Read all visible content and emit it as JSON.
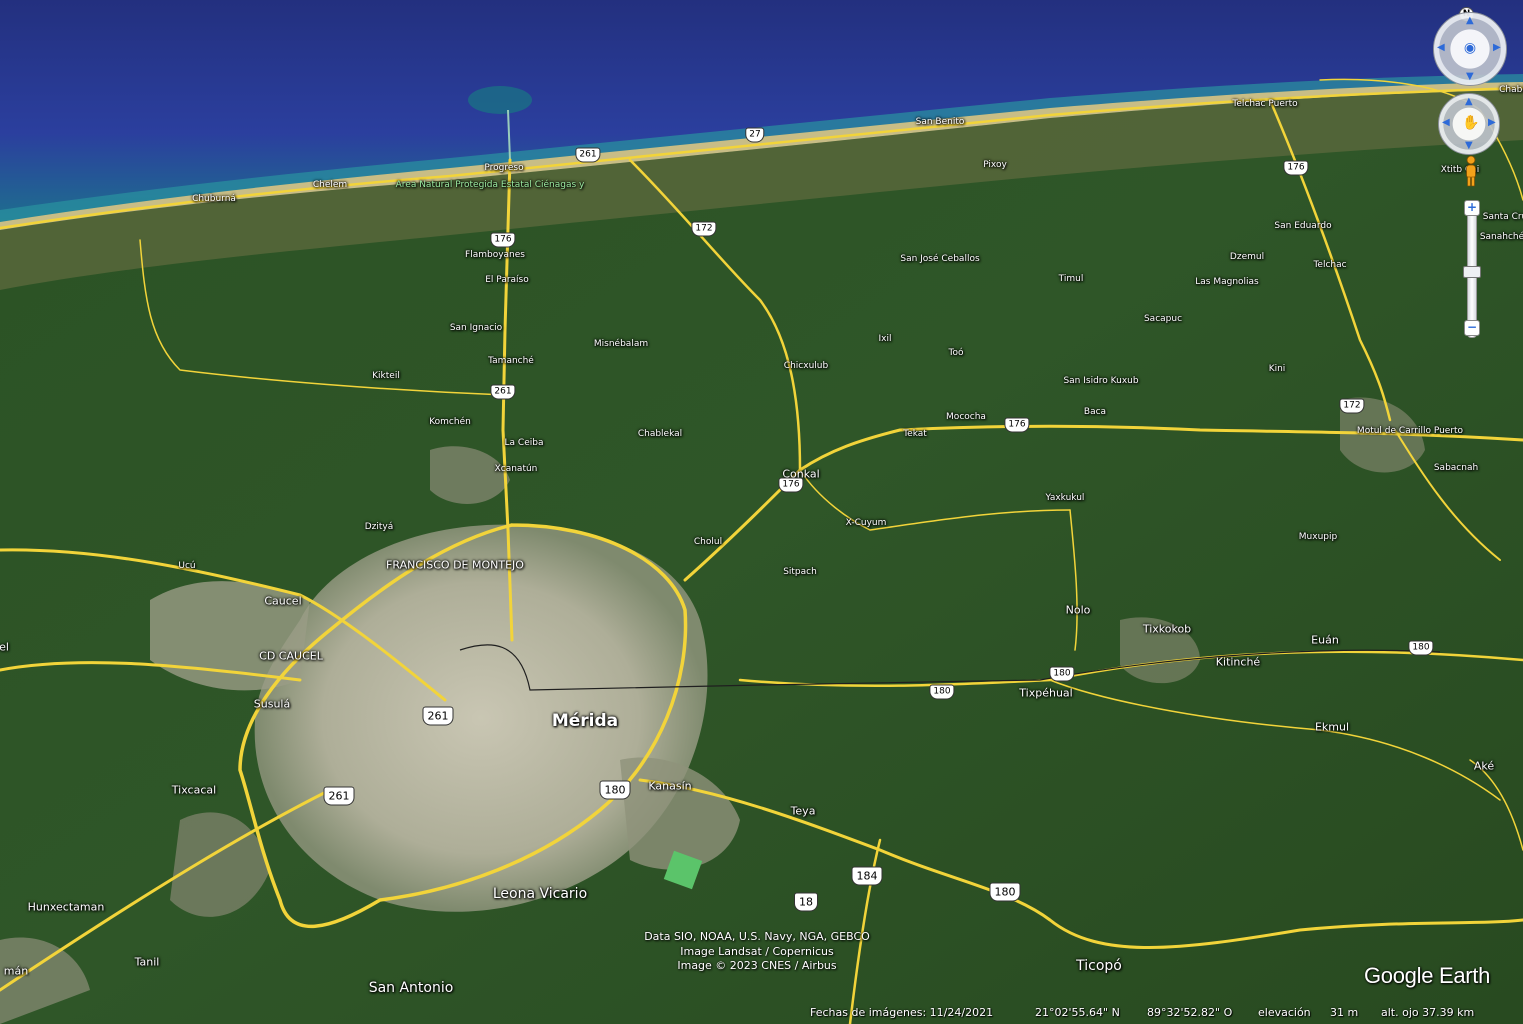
{
  "colors": {
    "ocean_deep": "#27368f",
    "ocean_shallow": "#1f7a8e",
    "beach": "#b9ad78",
    "land": "#2e5326",
    "urban": "#b7b6a2",
    "road": "#f2d43a",
    "label": "#ffffff",
    "accent": "#2d6ad8"
  },
  "places": [
    {
      "name": "Mérida",
      "size": "xl"
    },
    {
      "name": "Progreso",
      "size": "s"
    },
    {
      "name": "Chelem",
      "size": "s"
    },
    {
      "name": "Chuburná",
      "size": "s"
    },
    {
      "name": "Area Natural Protegida Estatal Ciénagas y",
      "size": "g"
    },
    {
      "name": "San Benito",
      "size": "s"
    },
    {
      "name": "Telchac Puerto",
      "size": "s"
    },
    {
      "name": "Chabi",
      "size": "s"
    },
    {
      "name": "Pixoy",
      "size": "s"
    },
    {
      "name": "Xtitb Cai",
      "size": "s"
    },
    {
      "name": "Santa Cru",
      "size": "s"
    },
    {
      "name": "Sanahché",
      "size": "s"
    },
    {
      "name": "San Eduardo",
      "size": "s"
    },
    {
      "name": "Dzemul",
      "size": "s"
    },
    {
      "name": "Telchac",
      "size": "s"
    },
    {
      "name": "Las Magnolias",
      "size": "s"
    },
    {
      "name": "Timul",
      "size": "s"
    },
    {
      "name": "San José Ceballos",
      "size": "s"
    },
    {
      "name": "Sacapuc",
      "size": "s"
    },
    {
      "name": "Flamboyanes",
      "size": "s"
    },
    {
      "name": "El Paraíso",
      "size": "s"
    },
    {
      "name": "San Ignacio",
      "size": "s"
    },
    {
      "name": "Misnébalam",
      "size": "s"
    },
    {
      "name": "Tamanché",
      "size": "s"
    },
    {
      "name": "Kikteil",
      "size": "s"
    },
    {
      "name": "Chicxulub",
      "size": "s"
    },
    {
      "name": "Ixil",
      "size": "s"
    },
    {
      "name": "Toó",
      "size": "s"
    },
    {
      "name": "San Isidro Kuxub",
      "size": "s"
    },
    {
      "name": "Kini",
      "size": "s"
    },
    {
      "name": "Baca",
      "size": "s"
    },
    {
      "name": "Mococha",
      "size": "s"
    },
    {
      "name": "Komchén",
      "size": "s"
    },
    {
      "name": "Chablekal",
      "size": "s"
    },
    {
      "name": "Tekat",
      "size": "s"
    },
    {
      "name": "Motul de Carrillo Puerto",
      "size": "s"
    },
    {
      "name": "La Ceiba",
      "size": "s"
    },
    {
      "name": "Xcanatún",
      "size": "s"
    },
    {
      "name": "Conkal",
      "size": "m"
    },
    {
      "name": "Sabacnah",
      "size": "s"
    },
    {
      "name": "Yaxkukul",
      "size": "s"
    },
    {
      "name": "Dzityá",
      "size": "s"
    },
    {
      "name": "X-Cuyum",
      "size": "s"
    },
    {
      "name": "Cholul",
      "size": "s"
    },
    {
      "name": "Muxupip",
      "size": "s"
    },
    {
      "name": "Ucú",
      "size": "s"
    },
    {
      "name": "FRANCISCO DE MONTEJO",
      "size": "m"
    },
    {
      "name": "Sitpach",
      "size": "s"
    },
    {
      "name": "Caucel",
      "size": "m"
    },
    {
      "name": "Nolo",
      "size": "m"
    },
    {
      "name": "Tixkokob",
      "size": "m"
    },
    {
      "name": "Euán",
      "size": "m"
    },
    {
      "name": "el",
      "size": "m"
    },
    {
      "name": "CD CAUCEL",
      "size": "m"
    },
    {
      "name": "Kitinché",
      "size": "m"
    },
    {
      "name": "Tixpéhual",
      "size": "m"
    },
    {
      "name": "Susulá",
      "size": "m"
    },
    {
      "name": "Ekmul",
      "size": "m"
    },
    {
      "name": "Tixcacal",
      "size": "m"
    },
    {
      "name": "Kanasín",
      "size": "m"
    },
    {
      "name": "Teya",
      "size": "m"
    },
    {
      "name": "Aké",
      "size": "m"
    },
    {
      "name": "Hunxectaman",
      "size": "m"
    },
    {
      "name": "Leona Vicario",
      "size": "l"
    },
    {
      "name": "Tanil",
      "size": "m"
    },
    {
      "name": "Ticopó",
      "size": "l"
    },
    {
      "name": "mán",
      "size": "m"
    },
    {
      "name": "San Antonio",
      "size": "l"
    }
  ],
  "roads": [
    "27",
    "261",
    "176",
    "172",
    "176",
    "172",
    "176",
    "261",
    "176",
    "261",
    "180",
    "180",
    "180",
    "261",
    "180",
    "184",
    "18",
    "180"
  ],
  "controls": {
    "north_label": "N",
    "zoom_in": "+",
    "zoom_out": "−",
    "look_icon": "eye-icon",
    "move_icon": "hand-icon",
    "street_view_icon": "pegman-icon",
    "zoom_level": 0.45
  },
  "attribution": [
    "Data SIO, NOAA, U.S. Navy, NGA, GEBCO",
    "Image Landsat / Copernicus",
    "Image © 2023 CNES / Airbus"
  ],
  "brand": "Google Earth",
  "status": {
    "imagery_date": "Fechas de imágenes: 11/24/2021",
    "latitude": "21°02'55.64\" N",
    "longitude": "89°32'52.82\" O",
    "elevation_label": "elevación",
    "elevation": "31 m",
    "eye_alt": "alt. ojo 37.39 km"
  }
}
